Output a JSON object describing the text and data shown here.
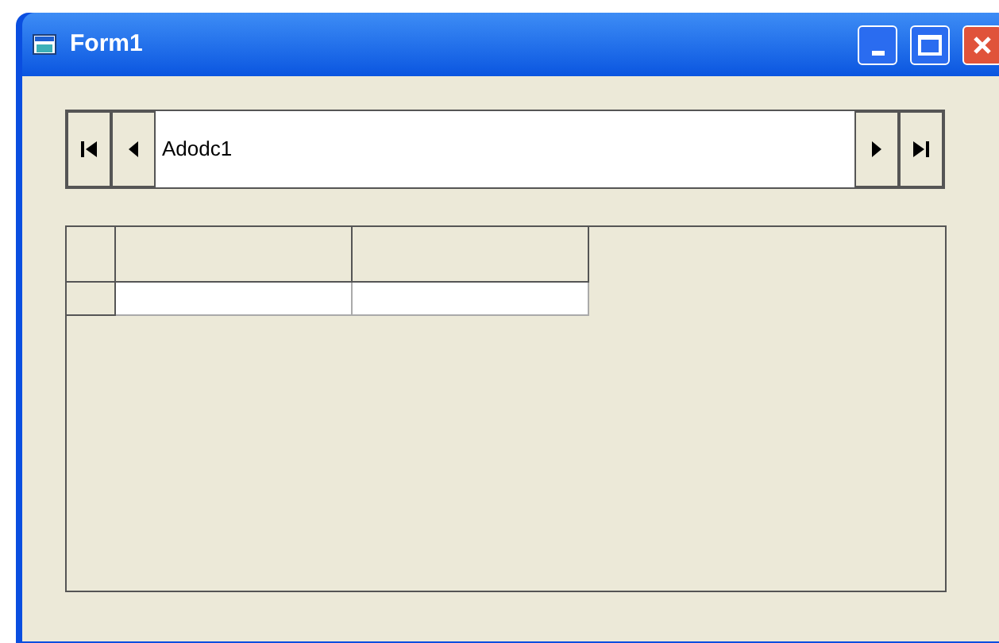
{
  "window": {
    "title": "Form1"
  },
  "data_control": {
    "caption": "Adodc1"
  }
}
